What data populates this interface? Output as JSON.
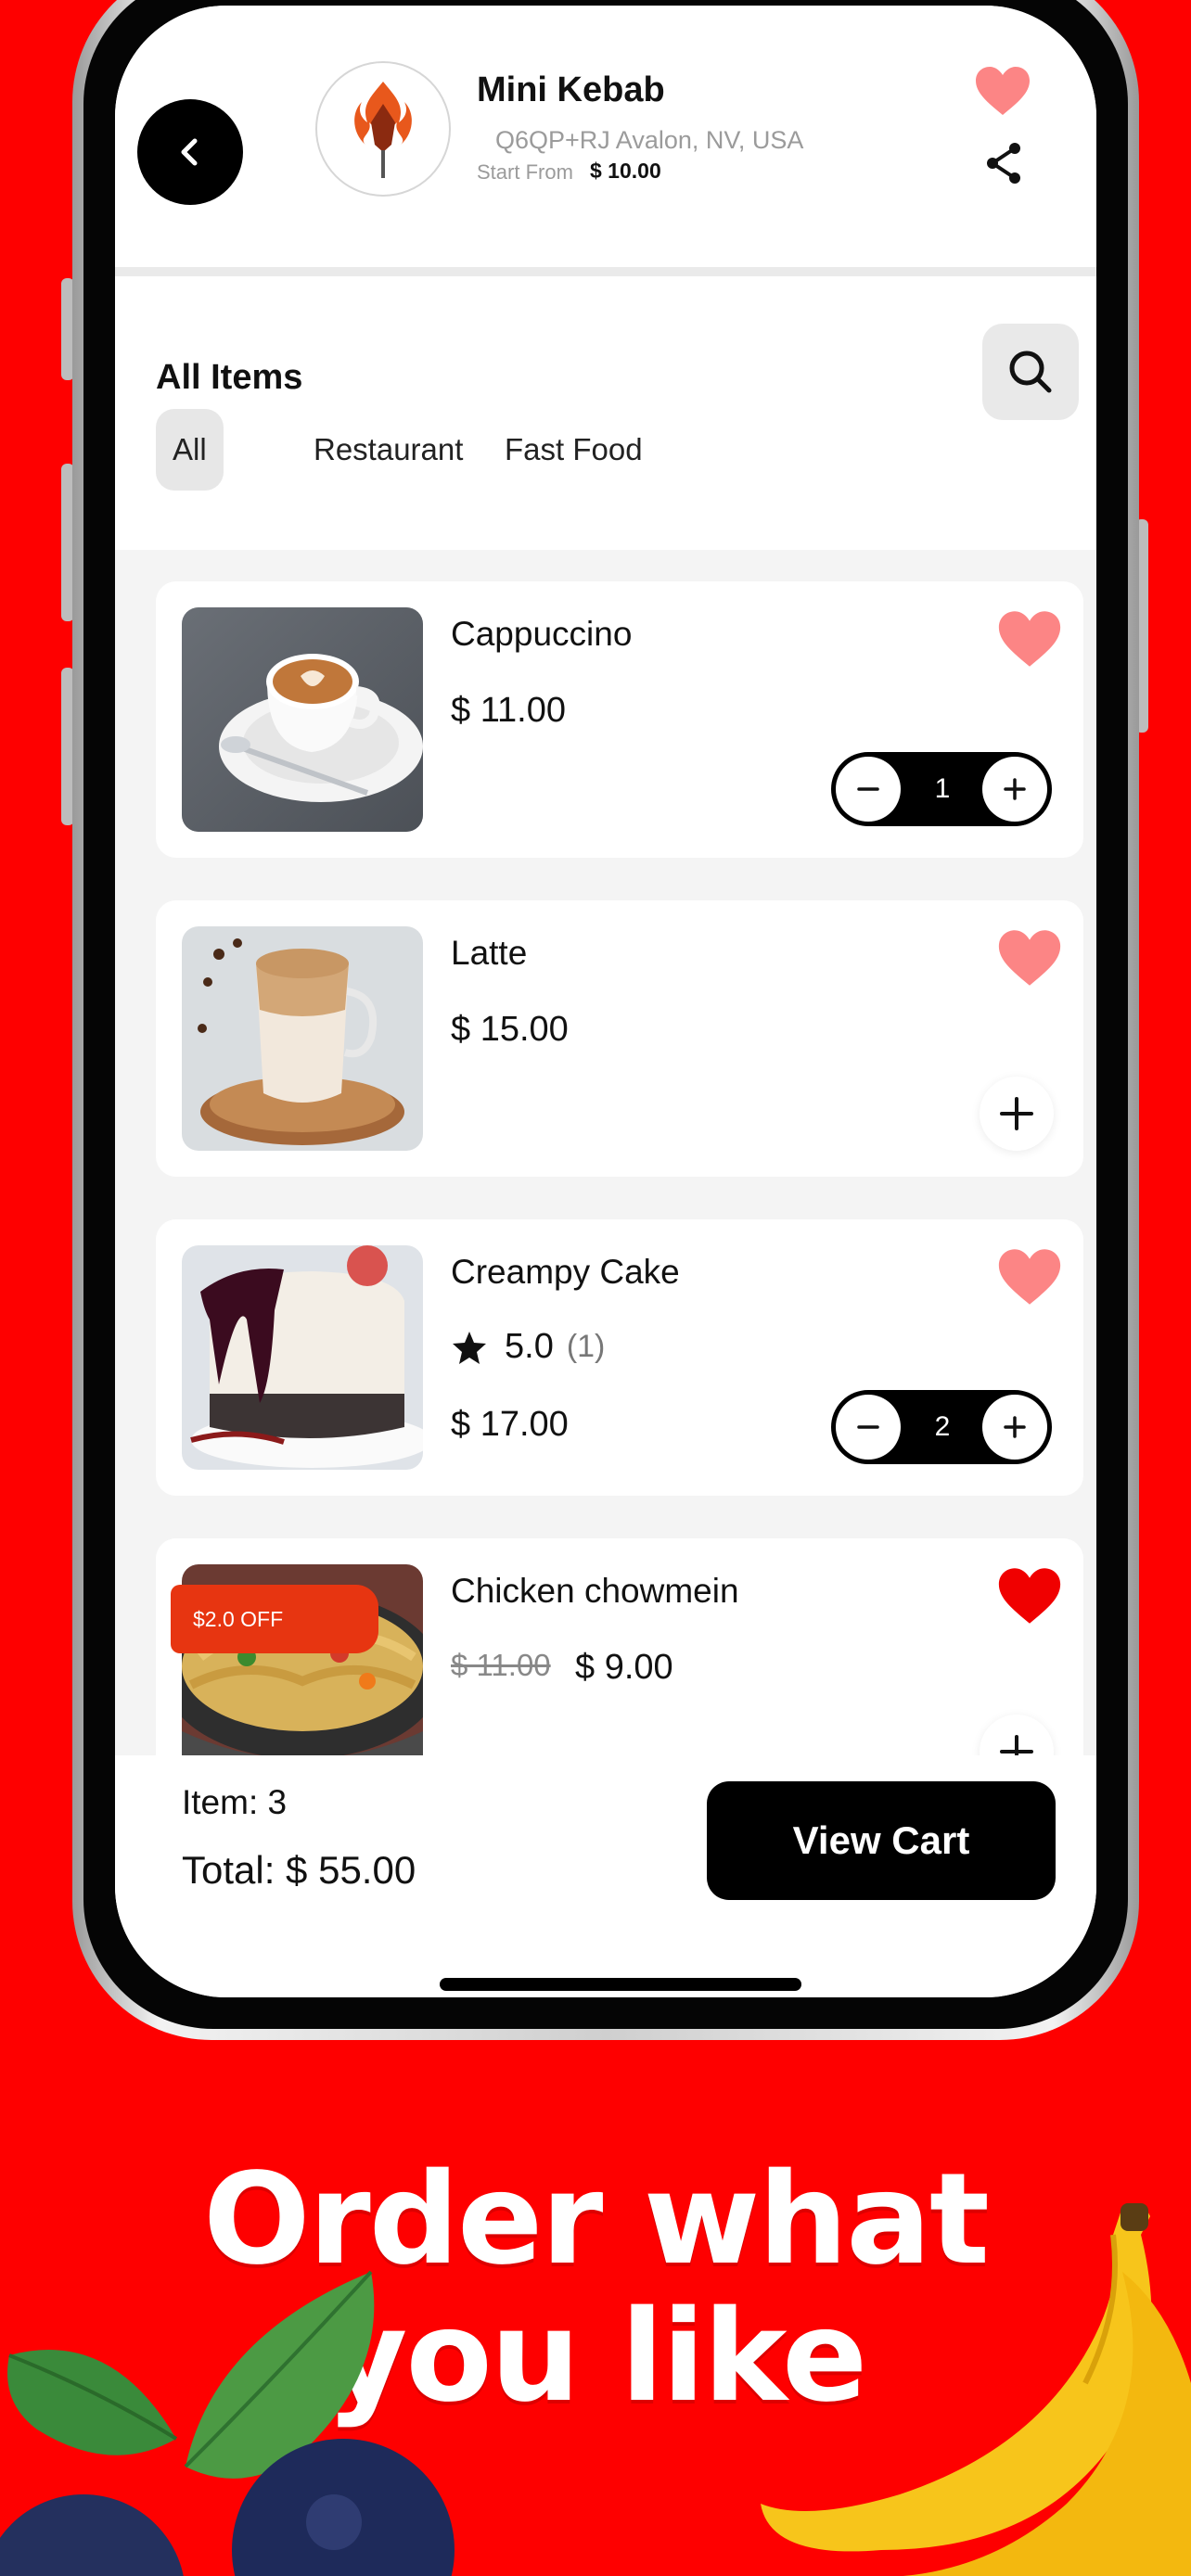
{
  "header": {
    "store_name": "Mini Kebab",
    "address": "Q6QP+RJ Avalon, NV, USA",
    "start_from_label": "Start From",
    "start_from_price": "$ 10.00"
  },
  "section": {
    "title": "All Items",
    "chips": [
      {
        "label": "All",
        "active": true
      },
      {
        "label": "Restaurant",
        "active": false
      },
      {
        "label": "Fast Food",
        "active": false
      }
    ]
  },
  "items": [
    {
      "name": "Cappuccino",
      "price": "$ 11.00",
      "qty": "1",
      "favorite": false
    },
    {
      "name": "Latte",
      "price": "$ 15.00",
      "favorite": false
    },
    {
      "name": "Creampy Cake",
      "rating": "5.0",
      "rating_count": "(1)",
      "price": "$ 17.00",
      "qty": "2",
      "favorite": false
    },
    {
      "name": "Chicken chowmein",
      "badge": "$2.0 OFF",
      "old_price": "$ 11.00",
      "price": "$ 9.00",
      "favorite": true
    }
  ],
  "footer": {
    "items_label": "Item: 3",
    "total_label": "Total: $ 55.00",
    "view_cart": "View Cart"
  },
  "promo": {
    "line1": "Order what",
    "line2": "you like"
  },
  "colors": {
    "background": "#fe0000",
    "heart_light": "#fc8585",
    "heart_active": "#f00000",
    "badge": "#e73511"
  }
}
